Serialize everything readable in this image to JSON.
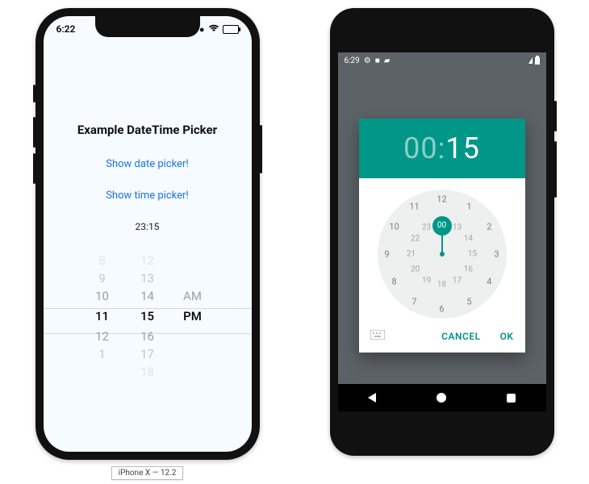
{
  "ios": {
    "statusbar_time": "6:22",
    "title": "Example DateTime Picker",
    "date_link": "Show date picker!",
    "time_link": "Show time picker!",
    "chosen_time": "23:15",
    "wheel_hours": [
      "8",
      "9",
      "10",
      "11",
      "12",
      "1"
    ],
    "wheel_minutes": [
      "12",
      "13",
      "14",
      "15",
      "16",
      "17",
      "18"
    ],
    "wheel_ampm": [
      "AM",
      "PM"
    ],
    "device_label": "iPhone X — 12.2"
  },
  "android": {
    "statusbar_time": "6:29",
    "header_hour": "00",
    "header_sep": ":",
    "header_min": "15",
    "selected_inner": "00",
    "outer_numbers": [
      "12",
      "1",
      "2",
      "3",
      "4",
      "5",
      "6",
      "7",
      "8",
      "9",
      "10",
      "11"
    ],
    "inner_numbers": [
      "00",
      "13",
      "14",
      "15",
      "16",
      "17",
      "18",
      "19",
      "20",
      "21",
      "22",
      "23"
    ],
    "cancel": "CANCEL",
    "ok": "OK"
  }
}
